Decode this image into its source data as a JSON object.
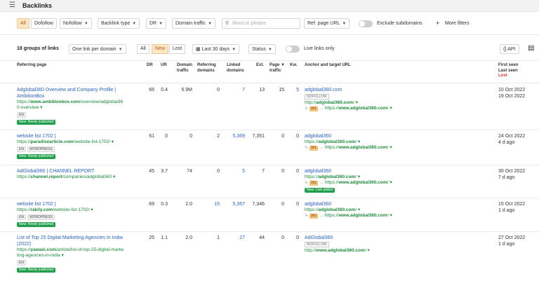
{
  "header": {
    "title": "Backlinks"
  },
  "filters": {
    "mode_all": "All",
    "mode_dofollow": "Dofollow",
    "mode_nofollow": "Nofollow",
    "backlink_type": "Backlink type",
    "dr": "DR",
    "domain_traffic": "Domain traffic",
    "search_placeholder": "Word or phrase",
    "ref_page_url": "Ref. page URL",
    "exclude_subdomains": "Exclude subdomains",
    "more_filters": "More filters"
  },
  "toolbar": {
    "groups_count": "18 groups of links",
    "per_domain": "One link per domain",
    "seg_all": "All",
    "seg_new": "New",
    "seg_lost": "Lost",
    "date_range": "Last 30 days",
    "status": "Status",
    "live_only": "Live links only",
    "api": "API"
  },
  "columns": {
    "referring_page": "Referring page",
    "dr": "DR",
    "ur": "UR",
    "domain_traffic_1": "Domain",
    "domain_traffic_2": "traffic",
    "ref_domains_1": "Referring",
    "ref_domains_2": "domains",
    "linked_domains_1": "Linked",
    "linked_domains_2": "domains",
    "ext": "Ext.",
    "page_traffic_1": "Page",
    "page_traffic_2": "traffic",
    "kw": "Kw.",
    "anchor": "Anchor and target URL",
    "first_seen": "First seen",
    "last_seen": "Last seen",
    "lost": "Lost"
  },
  "rows": [
    {
      "title_1": "Adglobal360 Overview and Company Profile |",
      "title_2": "AmbitionBox",
      "url_1": "https://",
      "url_domain": "www.ambitionbox.com",
      "url_2": "/overview/adglobal36",
      "url_3": "0-overview",
      "lang": "EN",
      "badge": "New: Newly published",
      "dr": "65",
      "ur": "0.4",
      "domain_traffic": "5.9M",
      "ref_domains": "0",
      "linked_domains": "7",
      "ext": "13",
      "page_traffic": "15",
      "kw": "5",
      "anchor": "adglobal360.com",
      "nofollow": "NOFOLLOW",
      "target_1": "http://",
      "target_domain": "adglobal360.com",
      "target_2": "/",
      "redirect": "301",
      "redirect_target_1": "https://",
      "redirect_target_domain": "www.adglobal360.com",
      "redirect_target_2": "/",
      "first_seen": "10 Oct 2022",
      "last_seen": "19 Oct 2022"
    },
    {
      "title_1": "website list 1702 |",
      "url_1": "https://",
      "url_domain": "paradisearticle.com",
      "url_2": "/website-list-1702/",
      "lang": "EN",
      "cms": "WORDPRESS",
      "badge": "New: Newly published",
      "dr": "61",
      "ur": "0",
      "domain_traffic": "0",
      "ref_domains": "2",
      "linked_domains": "5,369",
      "ext": "7,351",
      "page_traffic": "0",
      "kw": "0",
      "anchor": "adglobal360",
      "target_1": "https://",
      "target_domain": "adglobal360.com",
      "target_2": "/",
      "redirect": "301",
      "redirect_target_1": "https://",
      "redirect_target_domain": "www.adglobal360.com",
      "redirect_target_2": "/",
      "first_seen": "24 Oct 2022",
      "last_seen": "4 d ago"
    },
    {
      "title_1": "AdGlobal360 | CHANNEL REPORT",
      "url_1": "https://",
      "url_domain": "channel.report",
      "url_2": "/companies/adglobal360",
      "dr": "45",
      "ur": "3.7",
      "domain_traffic": "74",
      "ref_domains": "0",
      "linked_domains": "5",
      "ext": "7",
      "page_traffic": "0",
      "kw": "0",
      "anchor": "adglobal360",
      "target_1": "https://",
      "target_domain": "adglobal360.com",
      "target_2": "/",
      "redirect": "301",
      "redirect_target_1": "https://",
      "redirect_target_domain": "www.adglobal360.com",
      "redirect_target_2": "/",
      "anchor_badge": "New: Link added",
      "first_seen": "30 Oct 2022",
      "last_seen": "7 d ago"
    },
    {
      "title_1": "website list 1702 |",
      "url_1": "https://",
      "url_domain": "rakily.com",
      "url_2": "/website-list-1702/",
      "lang": "EN",
      "cms": "WORDPRESS",
      "badge": "New: Newly published",
      "dr": "69",
      "ur": "0.3",
      "domain_traffic": "2.0",
      "ref_domains": "15",
      "linked_domains": "5,367",
      "ext": "7,346",
      "page_traffic": "0",
      "kw": "0",
      "anchor": "adglobal360",
      "target_1": "https://",
      "target_domain": "adglobal360.com",
      "target_2": "/",
      "redirect": "301",
      "redirect_target_1": "https://",
      "redirect_target_domain": "www.adglobal360.com",
      "redirect_target_2": "/",
      "first_seen": "15 Oct 2022",
      "last_seen": "1 d ago"
    },
    {
      "title_1": "List of Top 25 Digital Marketing Agencies In India",
      "title_2": "(2022)",
      "url_1": "https://",
      "url_domain": "yawaxi.com",
      "url_2": "/article/list-of-top-25-digital-marke",
      "url_3": "ting-agencies-in-india",
      "lang": "EN",
      "badge": "New: Newly published",
      "dr": "25",
      "ur": "1.1",
      "domain_traffic": "2.0",
      "ref_domains": "1",
      "linked_domains": "27",
      "ext": "44",
      "page_traffic": "0",
      "kw": "0",
      "anchor": "AdGlobal360",
      "nofollow": "NOFOLLOW",
      "target_1": "http://",
      "target_domain": "www.adglobal360.com",
      "target_2": "/",
      "first_seen": "27 Oct 2022",
      "last_seen": "1 d ago"
    }
  ]
}
